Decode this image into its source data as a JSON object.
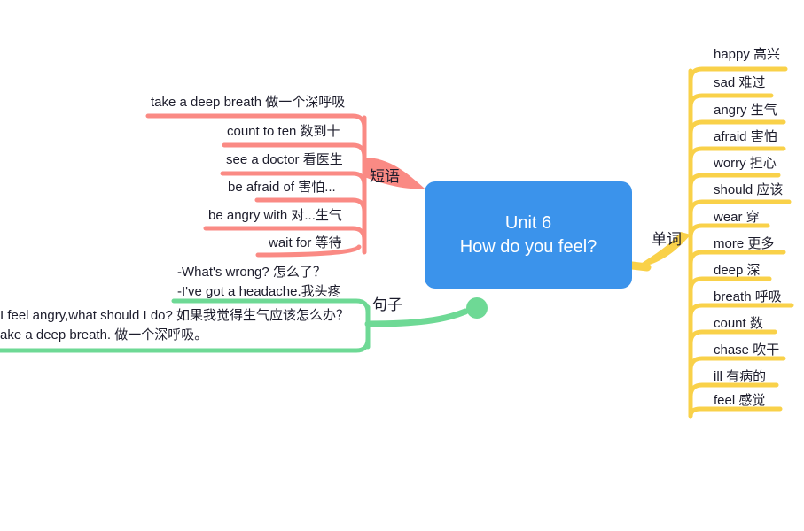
{
  "page": {
    "title": "Unit 6 How do you feel? mind map",
    "background": "#ffffff"
  },
  "colors": {
    "central": "#3b93eb",
    "central_text": "#ffffff",
    "phrases_branch": "#fa8a84",
    "words_branch": "#f9d149",
    "sentences_branch": "#6ed995",
    "text": "#1d1d2c"
  },
  "central": {
    "line1": "Unit 6",
    "line2": "How do you feel?"
  },
  "branches": [
    {
      "id": "phrases",
      "label": "短语",
      "color": "#fa8a84",
      "side": "left",
      "items": [
        {
          "text": "take a deep breath 做一个深呼吸"
        },
        {
          "text": "count to ten 数到十"
        },
        {
          "text": "see a doctor 看医生"
        },
        {
          "text": "be afraid of 害怕..."
        },
        {
          "text": "be angry with 对...生气"
        },
        {
          "text": "wait for 等待"
        }
      ]
    },
    {
      "id": "words",
      "label": "单词",
      "color": "#f9d149",
      "side": "right",
      "items": [
        {
          "text": "happy 高兴"
        },
        {
          "text": "sad 难过"
        },
        {
          "text": "angry 生气"
        },
        {
          "text": "afraid 害怕"
        },
        {
          "text": "worry 担心"
        },
        {
          "text": "should 应该"
        },
        {
          "text": "wear 穿"
        },
        {
          "text": "more 更多"
        },
        {
          "text": "deep 深"
        },
        {
          "text": "breath 呼吸"
        },
        {
          "text": "count 数"
        },
        {
          "text": "chase 吹干"
        },
        {
          "text": "ill 有病的"
        },
        {
          "text": "feel 感觉"
        }
      ]
    },
    {
      "id": "sentences",
      "label": "句子",
      "color": "#6ed995",
      "side": "left",
      "items": [
        {
          "lines": [
            "-What's wrong? 怎么了？",
            "-I've got a headache.我头疼"
          ]
        },
        {
          "lines": [
            "I feel angry,what should I do? 如果我觉得生气应该怎么办？",
            "ake a deep breath. 做一个深呼吸。"
          ]
        }
      ]
    }
  ]
}
